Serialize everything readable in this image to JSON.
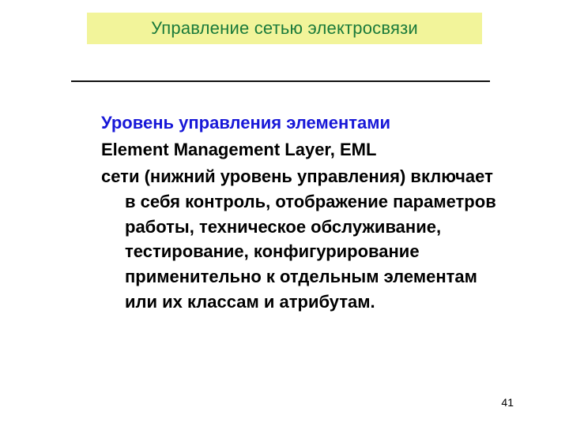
{
  "header": {
    "title": "Управление сетью электросвязи"
  },
  "content": {
    "line1": "Уровень управления элементами",
    "line2": "Element Management Layer, EML",
    "paragraph": "сети (нижний уровень управления) включает в себя контроль, отображение параметров работы, техническое обслуживание, тестирование, конфигурирование применительно к отдельным элементам или их классам и атрибутам."
  },
  "page_number": "41"
}
